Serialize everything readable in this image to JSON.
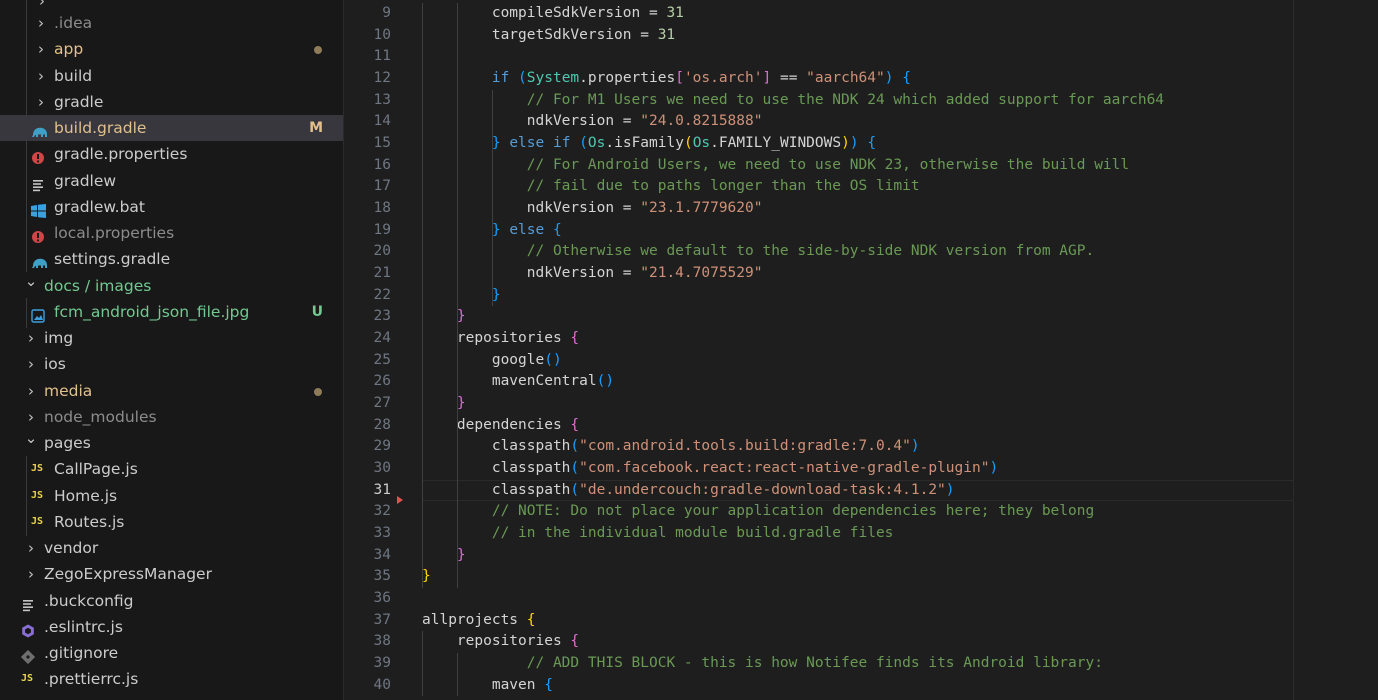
{
  "explorer": {
    "items": [
      {
        "label": ".idea",
        "kind": "folder",
        "depth": 1,
        "status": "ignored"
      },
      {
        "label": "app",
        "kind": "folder",
        "depth": 1,
        "status": "modified",
        "indicator": "dot"
      },
      {
        "label": "build",
        "kind": "folder",
        "depth": 1,
        "status": "normal"
      },
      {
        "label": "gradle",
        "kind": "folder",
        "depth": 1,
        "status": "normal"
      },
      {
        "label": "build.gradle",
        "kind": "gradle-file",
        "depth": 1,
        "status": "modified",
        "badge": "M",
        "selected": true
      },
      {
        "label": "gradle.properties",
        "kind": "properties-file",
        "depth": 1,
        "status": "normal"
      },
      {
        "label": "gradlew",
        "kind": "text-file",
        "depth": 1,
        "status": "normal"
      },
      {
        "label": "gradlew.bat",
        "kind": "windows-file",
        "depth": 1,
        "status": "normal"
      },
      {
        "label": "local.properties",
        "kind": "properties-file",
        "depth": 1,
        "status": "ignored"
      },
      {
        "label": "settings.gradle",
        "kind": "gradle-file",
        "depth": 1,
        "status": "normal"
      },
      {
        "label": "docs / images",
        "kind": "folder-open",
        "depth": 0,
        "status": "untracked"
      },
      {
        "label": "fcm_android_json_file.jpg",
        "kind": "image-file",
        "depth": 1,
        "status": "untracked",
        "badge": "U"
      },
      {
        "label": "img",
        "kind": "folder",
        "depth": 0,
        "status": "normal"
      },
      {
        "label": "ios",
        "kind": "folder",
        "depth": 0,
        "status": "normal"
      },
      {
        "label": "media",
        "kind": "folder",
        "depth": 0,
        "status": "modified",
        "indicator": "dot"
      },
      {
        "label": "node_modules",
        "kind": "folder",
        "depth": 0,
        "status": "ignored"
      },
      {
        "label": "pages",
        "kind": "folder-open",
        "depth": 0,
        "status": "normal"
      },
      {
        "label": "CallPage.js",
        "kind": "js-file",
        "depth": 1,
        "status": "normal"
      },
      {
        "label": "Home.js",
        "kind": "js-file",
        "depth": 1,
        "status": "normal"
      },
      {
        "label": "Routes.js",
        "kind": "js-file",
        "depth": 1,
        "status": "normal"
      },
      {
        "label": "vendor",
        "kind": "folder",
        "depth": 0,
        "status": "normal"
      },
      {
        "label": "ZegoExpressManager",
        "kind": "folder",
        "depth": 0,
        "status": "normal"
      },
      {
        "label": ".buckconfig",
        "kind": "text-file",
        "depth": 0,
        "status": "normal"
      },
      {
        "label": ".eslintrc.js",
        "kind": "eslint-file",
        "depth": 0,
        "status": "normal"
      },
      {
        "label": ".gitignore",
        "kind": "git-file",
        "depth": 0,
        "status": "normal"
      },
      {
        "label": ".prettierrc.js",
        "kind": "js-file",
        "depth": 0,
        "status": "normal"
      }
    ]
  },
  "editor": {
    "active_line": 31,
    "lines": [
      {
        "n": 9,
        "html": "        compileSdkVersion = <span class=\"t-num\">31</span>"
      },
      {
        "n": 10,
        "html": "        targetSdkVersion = <span class=\"t-num\">31</span>"
      },
      {
        "n": 11,
        "html": ""
      },
      {
        "n": 12,
        "html": "        <span class=\"t-kw\">if</span> <span class=\"t-b3\">(</span><span class=\"t-ty\">System</span>.properties<span class=\"t-b2\">[</span><span class=\"t-str\">'os.arch'</span><span class=\"t-b2\">]</span> == <span class=\"t-str\">\"aarch64\"</span><span class=\"t-b3\">)</span> <span class=\"t-b3\">{</span>"
      },
      {
        "n": 13,
        "html": "            <span class=\"t-cm\">// For M1 Users we need to use the NDK 24 which added support for aarch64</span>"
      },
      {
        "n": 14,
        "html": "            ndkVersion = <span class=\"t-str\">\"24.0.8215888\"</span>"
      },
      {
        "n": 15,
        "html": "        <span class=\"t-b3\">}</span> <span class=\"t-kw\">else</span> <span class=\"t-kw\">if</span> <span class=\"t-b3\">(</span><span class=\"t-ty\">Os</span>.isFamily<span class=\"t-b1\">(</span><span class=\"t-ty\">Os</span>.FAMILY_WINDOWS<span class=\"t-b1\">)</span><span class=\"t-b3\">)</span> <span class=\"t-b3\">{</span>"
      },
      {
        "n": 16,
        "html": "            <span class=\"t-cm\">// For Android Users, we need to use NDK 23, otherwise the build will</span>"
      },
      {
        "n": 17,
        "html": "            <span class=\"t-cm\">// fail due to paths longer than the OS limit</span>"
      },
      {
        "n": 18,
        "html": "            ndkVersion = <span class=\"t-str\">\"23.1.7779620\"</span>"
      },
      {
        "n": 19,
        "html": "        <span class=\"t-b3\">}</span> <span class=\"t-kw\">else</span> <span class=\"t-b3\">{</span>"
      },
      {
        "n": 20,
        "html": "            <span class=\"t-cm\">// Otherwise we default to the side-by-side NDK version from AGP.</span>"
      },
      {
        "n": 21,
        "html": "            ndkVersion = <span class=\"t-str\">\"21.4.7075529\"</span>"
      },
      {
        "n": 22,
        "html": "        <span class=\"t-b3\">}</span>"
      },
      {
        "n": 23,
        "html": "    <span class=\"t-b2\">}</span>"
      },
      {
        "n": 24,
        "html": "    repositories <span class=\"t-b2\">{</span>"
      },
      {
        "n": 25,
        "html": "        google<span class=\"t-b3\">()</span>"
      },
      {
        "n": 26,
        "html": "        mavenCentral<span class=\"t-b3\">()</span>"
      },
      {
        "n": 27,
        "html": "    <span class=\"t-b2\">}</span>"
      },
      {
        "n": 28,
        "html": "    dependencies <span class=\"t-b2\">{</span>"
      },
      {
        "n": 29,
        "html": "        classpath<span class=\"t-b3\">(</span><span class=\"t-str\">\"com.android.tools.build:gradle:7.0.4\"</span><span class=\"t-b3\">)</span>"
      },
      {
        "n": 30,
        "html": "        classpath<span class=\"t-b3\">(</span><span class=\"t-str\">\"com.facebook.react:react-native-gradle-plugin\"</span><span class=\"t-b3\">)</span>"
      },
      {
        "n": 31,
        "html": "        classpath<span class=\"t-b3\">(</span><span class=\"t-str\">\"de.undercouch:gradle-download-task:4.1.2\"</span><span class=\"t-b3\">)</span>"
      },
      {
        "n": 32,
        "html": "        <span class=\"t-cm\">// NOTE: Do not place your application dependencies here; they belong</span>"
      },
      {
        "n": 33,
        "html": "        <span class=\"t-cm\">// in the individual module build.gradle files</span>"
      },
      {
        "n": 34,
        "html": "    <span class=\"t-b2\">}</span>"
      },
      {
        "n": 35,
        "html": "<span class=\"t-b1\">}</span>"
      },
      {
        "n": 36,
        "html": ""
      },
      {
        "n": 37,
        "html": "allprojects <span class=\"t-b1\">{</span>"
      },
      {
        "n": 38,
        "html": "    repositories <span class=\"t-b2\">{</span>"
      },
      {
        "n": 39,
        "html": "            <span class=\"t-cm\">// ADD THIS BLOCK - this is how Notifee finds its Android library:</span>"
      },
      {
        "n": 40,
        "html": "        maven <span class=\"t-b3\">{</span>"
      }
    ]
  }
}
